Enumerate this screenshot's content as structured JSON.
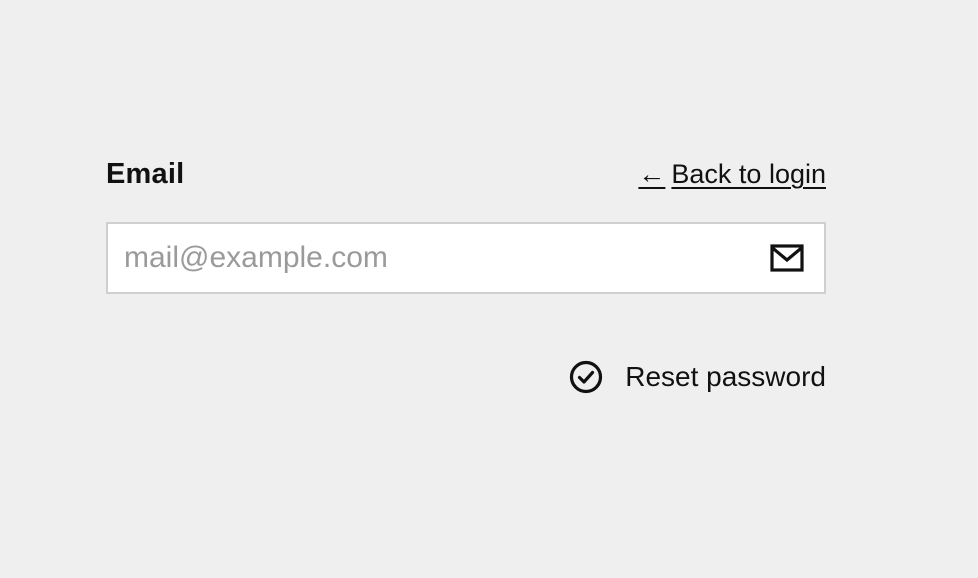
{
  "form": {
    "email_label": "Email",
    "back_link": {
      "arrow": "←",
      "label": "Back to login"
    },
    "email_input": {
      "value": "",
      "placeholder": "mail@example.com",
      "icon": "envelope-icon"
    },
    "submit_button": {
      "label": "Reset password",
      "icon": "check-circle-icon"
    }
  },
  "colors": {
    "background": "#efefef",
    "text": "#111111",
    "placeholder": "#9a9a9a",
    "input_border": "#cfcfcf",
    "input_background": "#ffffff"
  }
}
